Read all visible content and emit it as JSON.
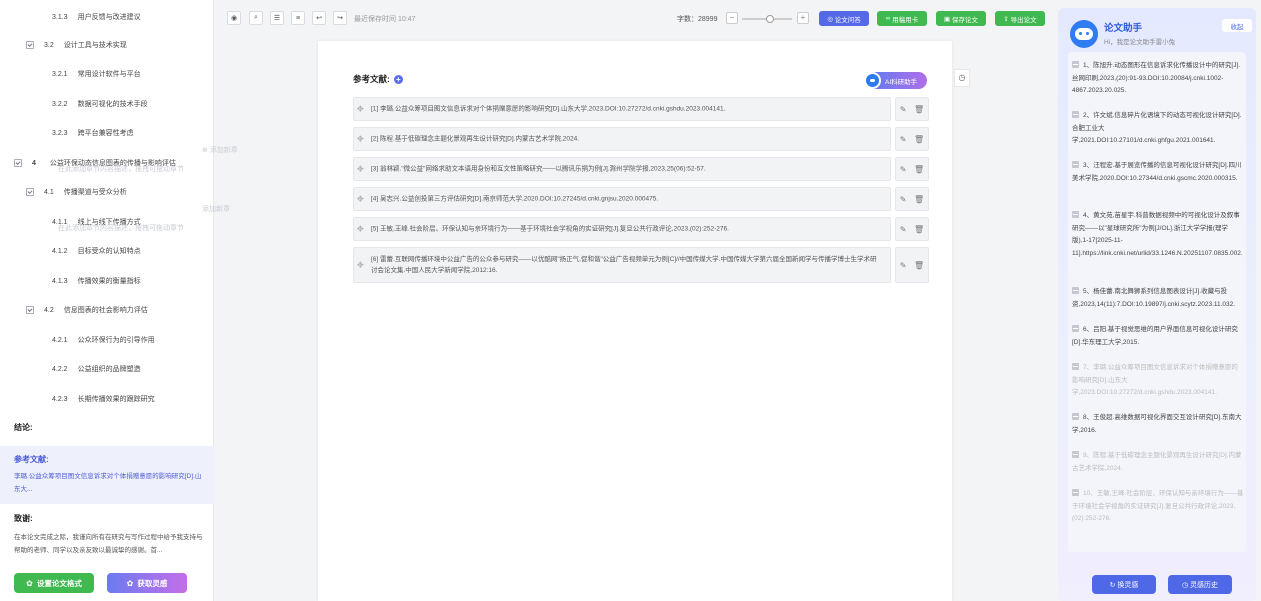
{
  "outline": [
    {
      "num": "3.1.3",
      "label": "用户反馈与改进建议",
      "level": 3
    },
    {
      "num": "3.2",
      "label": "设计工具与技术实现",
      "level": 2
    },
    {
      "num": "3.2.1",
      "label": "常用设计软件与平台",
      "level": 3
    },
    {
      "num": "3.2.2",
      "label": "数据可视化的技术手段",
      "level": 3
    },
    {
      "num": "3.2.3",
      "label": "跨平台兼容性考虑",
      "level": 3
    },
    {
      "num": "4",
      "label": "公益环保动态信息图表的传播与影响评估",
      "level": 1
    },
    {
      "num": "4.1",
      "label": "传播渠道与受众分析",
      "level": 2
    },
    {
      "num": "4.1.1",
      "label": "线上与线下传播方式",
      "level": 3
    },
    {
      "num": "4.1.2",
      "label": "目标受众的认知特点",
      "level": 3
    },
    {
      "num": "4.1.3",
      "label": "传播效果的衡量指标",
      "level": 3
    },
    {
      "num": "4.2",
      "label": "信息图表的社会影响力评估",
      "level": 2
    },
    {
      "num": "4.2.1",
      "label": "公众环保行为的引导作用",
      "level": 3
    },
    {
      "num": "4.2.2",
      "label": "公益组织的品牌塑造",
      "level": 3
    },
    {
      "num": "4.2.3",
      "label": "长期传播效果的跟踪研究",
      "level": 3
    }
  ],
  "ghost": {
    "add1": "⊕ 添加新章",
    "line1": "在此添加章节内容描述，拖拽可拖动章节",
    "add2": "添加新章",
    "line2": "在此添加章节内容描述，拖拽可拖动章节"
  },
  "sidebar": {
    "conclusion": "结论:",
    "ref_title": "参考文献:",
    "ref_preview": "李璐.公益众筹项目图文信息诉求对个体捐赠意愿的影响研究[D].山东大...",
    "ack_title": "致谢:",
    "ack_preview": "在本论文完成之际，我谨向所有在研究与写作过程中给予我支持与帮助的老师、同学以及亲友致以最诚挚的感谢。首...",
    "btn_format": "设置论文格式",
    "btn_inspire": "获取灵感"
  },
  "toolbar": {
    "autosave": "最近保存时间 10:47",
    "word_count_label": "字数：",
    "word_count": "28999",
    "btn_qa": "论文问答",
    "btn_card": "用稿用卡",
    "btn_save": "保存论文",
    "btn_export": "导出论文"
  },
  "doc": {
    "title": "参考文献:",
    "ai_btn": "AI科研助手",
    "refs": [
      "[1] 李璐.公益众筹项目图文信息诉求对个体捐赠意愿的影响研究[D].山东大学,2023.DOI:10.27272/d.cnki.gshdu.2023.004141.",
      "[2] 陈程.基于低碳理念主题化景观再生设计研究[D].内蒙古艺术学院,2024.",
      "[3] 翁林颖.\"微公益\"网络求助文本语用身份和互文性策略研究——以腾讯乐捐为例[J].滁州学院学报,2023,25(06):52-57.",
      "[4] 吴志兴.公益创投第三方评估研究[D].南京师范大学,2020.DOI:10.27245/d.cnki.gnjsu.2020.000475.",
      "[5] 王敏,王峰.社会阶层、环保认知与亲环境行为——基于环境社会学视角的实证研究[J].复旦公共行政评论,2023,(02):252-276.",
      "[6] 雷蕾.互联网传播环境中公益广告的公众参与研究——以优酷网\"扬正气,促和谐\"公益广告视频单元为例[C]//中国传媒大学.中国传媒大学第六届全国新闻学与传播学博士生学术研讨会论文集.中国人民大学新闻学院,2012:16."
    ]
  },
  "assistant": {
    "title": "论文助手",
    "subtitle": "Hi，我是论文助手雷小兔",
    "collapse": "收起",
    "items": [
      {
        "text": "1、陈旭升.动态图形在信息诉求化传播设计中的研究[J].丝网印刷,2023,(20):91-93.DOI:10.20084/j.cnki.1002-4867.2023.20.025.",
        "dim": false
      },
      {
        "text": "2、许文斌.信息碎片化语境下的动态可视化设计研究[D].合肥工业大学,2021.DOI:10.27101/d.cnki.ghfgu.2021.001641.",
        "dim": false
      },
      {
        "text": "3、汪程宏.基于展览传播的信息可视化设计研究[D].四川美术学院,2020.DOI:10.27344/d.cnki.gscmc.2020.000315.",
        "dim": false
      },
      {
        "text": "4、黄文苑,苗星宇.科普数据视频中的可视化设计及叙事研究——以\"星球研究所\"为例[J/OL].浙江大学学报(理学版),1-17[2025-11-11].https://link.cnki.net/urlid/33.1246.N.20251107.0835.002.",
        "dim": false
      },
      {
        "text": "5、杨佳蕾.南北舞狮系列信息图表设计[J].收藏与投资,2023,14(11):7.DOI:10.19897/j.cnki.scytz.2023.11.032.",
        "dim": false
      },
      {
        "text": "6、吕阳.基于视觉思维的用户界面信息可视化设计研究[D].华东理工大学,2015.",
        "dim": false
      },
      {
        "text": "7、李璐.公益众筹项目图文信息诉求对个体捐赠意愿的影响研究[D].山东大学,2023.DOI:10.27272/d.cnki.gshdu.2023.004141.",
        "dim": true
      },
      {
        "text": "8、王俊超.高维数据可视化界面交互设计研究[D].东南大学,2016.",
        "dim": false
      },
      {
        "text": "9、陈程.基于低碳理念主题化景观再生设计研究[D].内蒙古艺术学院,2024.",
        "dim": true
      },
      {
        "text": "10、王敏,王峰.社会阶层、环保认知与亲环境行为——基于环境社会学视角的实证研究[J].复旦公共行政评论,2023,(02):252-276.",
        "dim": true
      }
    ],
    "btn_refresh": "换灵感",
    "btn_history": "灵感历史"
  },
  "colors": {
    "accent": "#4f68e8",
    "green": "#3fb950"
  }
}
